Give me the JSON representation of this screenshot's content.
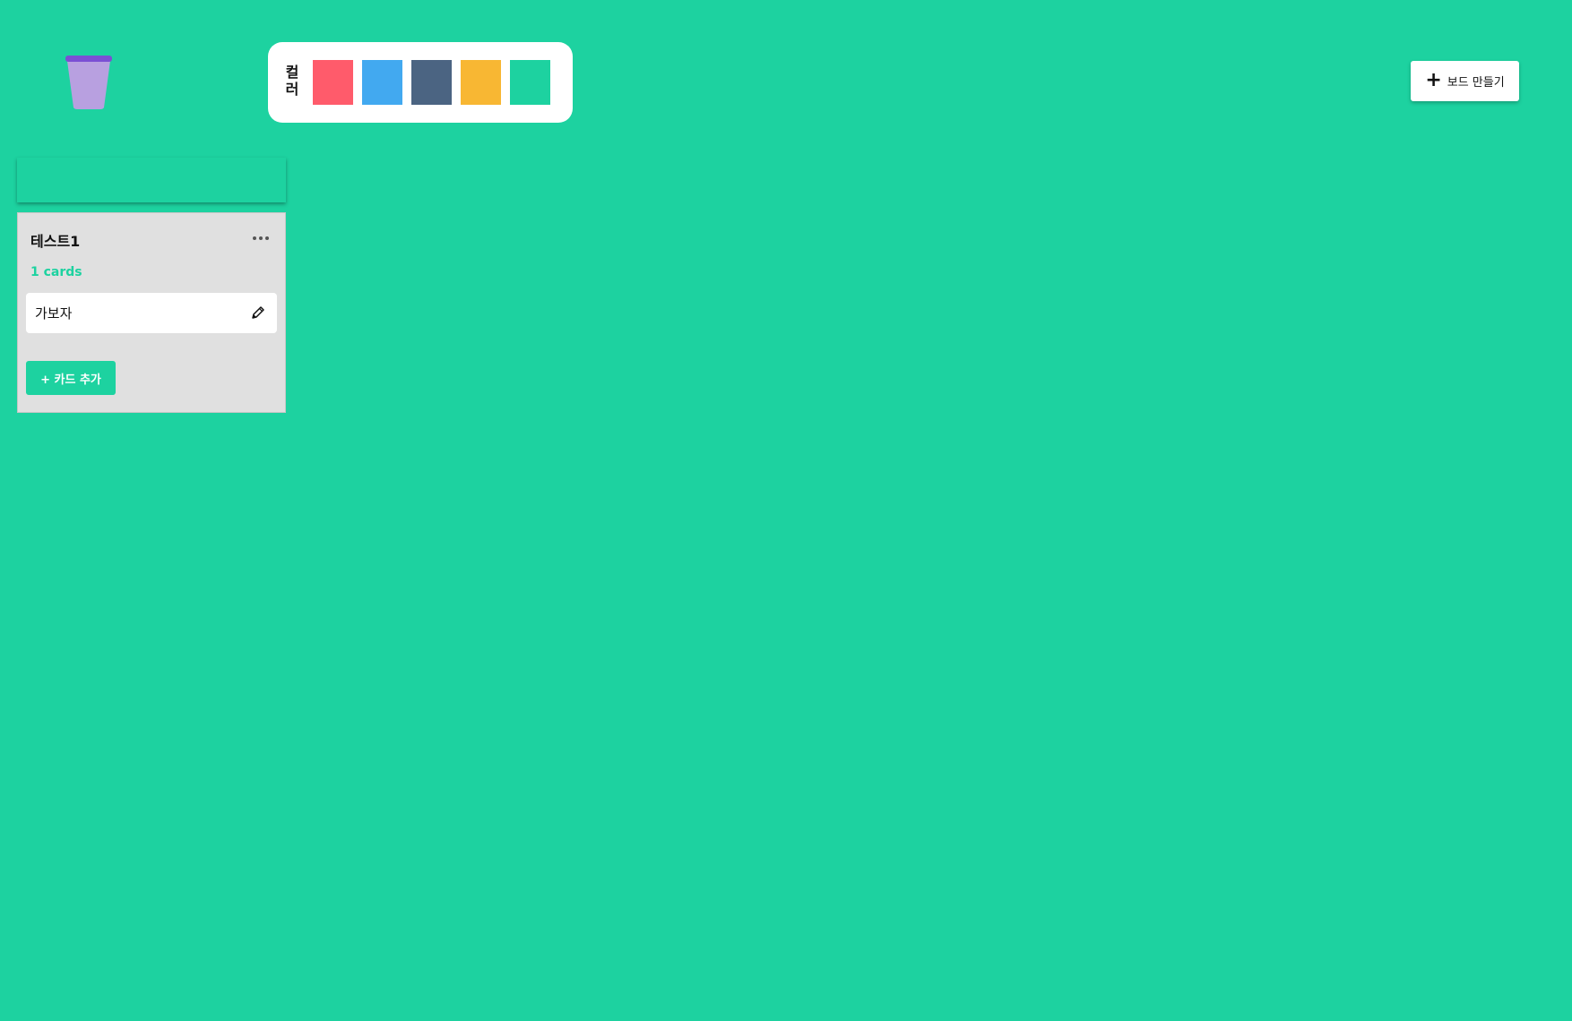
{
  "trash": {
    "icon": "trash-bin-icon",
    "lid_color": "#7b4fd4",
    "body_color": "#b8a0e0"
  },
  "palette": {
    "label": "컬러",
    "swatches": [
      {
        "name": "red",
        "color": "#ff5b6b"
      },
      {
        "name": "blue",
        "color": "#42a9f0"
      },
      {
        "name": "navy",
        "color": "#4b6482"
      },
      {
        "name": "yellow",
        "color": "#f8b733"
      },
      {
        "name": "green",
        "color": "#1dd2a0"
      }
    ]
  },
  "toolbar": {
    "create_board_label": "보드 만들기",
    "create_board_icon": "plus-icon",
    "create_board_plus": "+"
  },
  "board": {
    "header_color": "#1dd2a0",
    "columns": [
      {
        "title": "테스트1",
        "count_label": "1 cards",
        "more_icon": "more-horizontal-icon",
        "cards": [
          {
            "text": "가보자",
            "edit_icon": "pencil-icon"
          }
        ],
        "add_card_label": "+ 카드 추가"
      }
    ]
  },
  "colors": {
    "background": "#1dd2a0",
    "column_bg": "#e0e0e0",
    "accent": "#1dd2a0"
  }
}
